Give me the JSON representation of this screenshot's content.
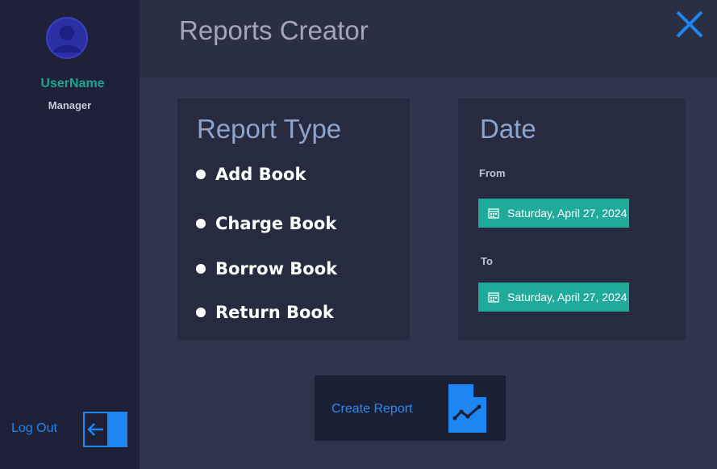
{
  "sidebar": {
    "username": "UserName",
    "role": "Manager",
    "logout_label": "Log Out",
    "icons": {
      "avatar": "user-avatar-icon",
      "logout": "logout-arrow-icon"
    }
  },
  "header": {
    "title": "Reports Creator",
    "close_icon": "close-icon"
  },
  "report_type": {
    "heading": "Report Type",
    "options": [
      "Add Book",
      "Charge Book",
      "Borrow Book",
      "Return Book"
    ]
  },
  "date": {
    "heading": "Date",
    "from_label": "From",
    "from_value": "Saturday, April 27, 2024",
    "to_label": "To",
    "to_value": "Saturday, April 27, 2024"
  },
  "create_button": {
    "label": "Create Report",
    "icon": "report-chart-icon"
  },
  "colors": {
    "sidebar_bg": "#1e2137",
    "accent_blue": "#1e86f2",
    "accent_teal": "#20aa9a",
    "username_green": "#1ca591"
  }
}
